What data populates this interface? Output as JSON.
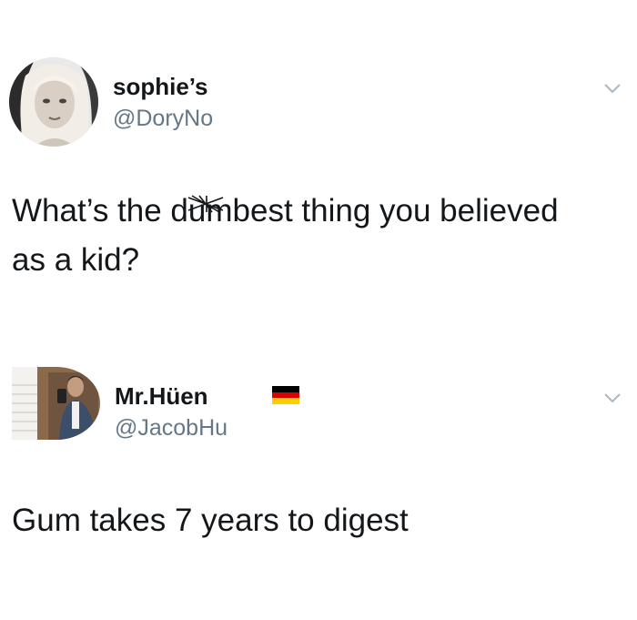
{
  "tweets": [
    {
      "display_name": "sophie’s",
      "handle": "@DoryNo",
      "text_line1": "What’s the d",
      "text_censored": "um",
      "text_line1_rest": "best thing you believed",
      "text_line2": "as a kid?",
      "avatar_icon": "profile-photo",
      "menu_icon": "chevron-down-icon"
    },
    {
      "display_name": "Mr.Hüen",
      "handle": "@JacobHu",
      "flag_icon": "germany-flag-icon",
      "text": "Gum takes 7 years to digest",
      "avatar_icon": "profile-photo",
      "menu_icon": "chevron-down-icon"
    }
  ],
  "colors": {
    "text": "#14171a",
    "secondary": "#657786",
    "chevron": "#aab8c2",
    "flag_black": "#000000",
    "flag_red": "#dd0000",
    "flag_gold": "#ffce00"
  }
}
